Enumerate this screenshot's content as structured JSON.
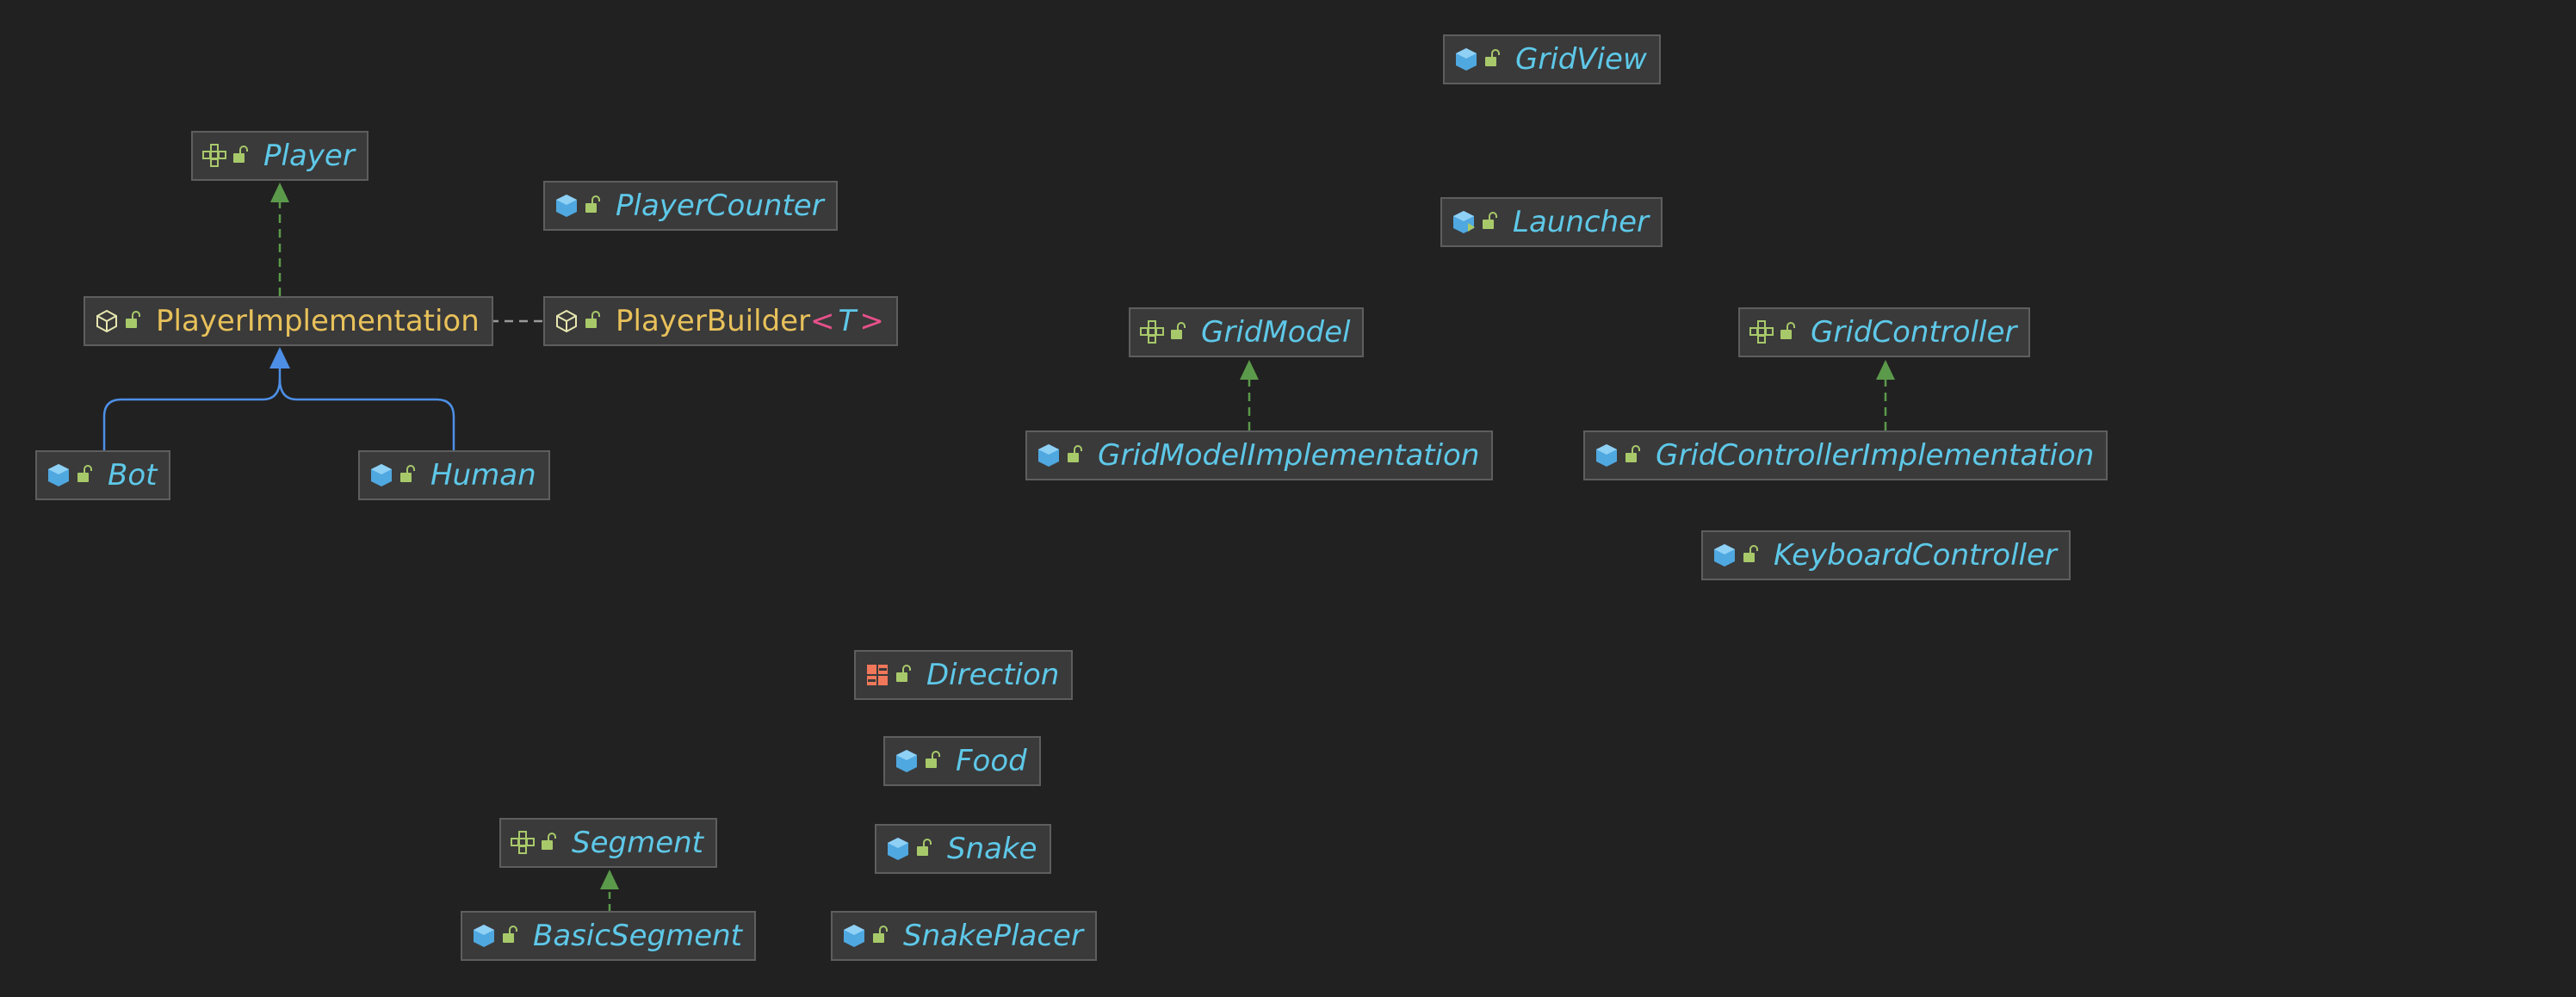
{
  "diagram": {
    "nodes": {
      "player": {
        "label": "Player",
        "kind": "interface-icon"
      },
      "player_counter": {
        "label": "PlayerCounter",
        "kind": "class-icon"
      },
      "player_implementation": {
        "label": "PlayerImplementation",
        "kind": "open-class-icon"
      },
      "player_builder": {
        "label": "PlayerBuilder",
        "type_param": "T",
        "lt": "<",
        "gt": ">",
        "kind": "open-class-icon"
      },
      "bot": {
        "label": "Bot",
        "kind": "class-icon"
      },
      "human": {
        "label": "Human",
        "kind": "class-icon"
      },
      "grid_view": {
        "label": "GridView",
        "kind": "class-icon"
      },
      "launcher": {
        "label": "Launcher",
        "kind": "launcher-class-icon"
      },
      "grid_model": {
        "label": "GridModel",
        "kind": "interface-icon"
      },
      "grid_controller": {
        "label": "GridController",
        "kind": "interface-icon"
      },
      "grid_model_implementation": {
        "label": "GridModelImplementation",
        "kind": "class-icon"
      },
      "grid_controller_implementation": {
        "label": "GridControllerImplementation",
        "kind": "class-icon"
      },
      "keyboard_controller": {
        "label": "KeyboardController",
        "kind": "class-icon"
      },
      "direction": {
        "label": "Direction",
        "kind": "enum-icon"
      },
      "food": {
        "label": "Food",
        "kind": "class-icon"
      },
      "segment": {
        "label": "Segment",
        "kind": "interface-icon"
      },
      "snake": {
        "label": "Snake",
        "kind": "class-icon"
      },
      "basic_segment": {
        "label": "BasicSegment",
        "kind": "class-icon"
      },
      "snake_placer": {
        "label": "SnakePlacer",
        "kind": "class-icon"
      }
    },
    "edges": [
      {
        "from": "player_implementation",
        "to": "player",
        "type": "realization"
      },
      {
        "from": "player_builder",
        "to": "player_implementation",
        "type": "dependency"
      },
      {
        "from": "bot",
        "to": "player_implementation",
        "type": "generalization"
      },
      {
        "from": "human",
        "to": "player_implementation",
        "type": "generalization"
      },
      {
        "from": "grid_model_implementation",
        "to": "grid_model",
        "type": "realization"
      },
      {
        "from": "grid_controller_implementation",
        "to": "grid_controller",
        "type": "realization"
      },
      {
        "from": "basic_segment",
        "to": "segment",
        "type": "realization"
      }
    ]
  },
  "colors": {
    "background": "#212121",
    "node_fill": "#3a3a3a",
    "node_border": "#5e5e5e",
    "label_text": "#5ec8e8",
    "open_class_text": "#e8c15a",
    "type_bracket": "#e8508a",
    "realization_edge": "#5b9a4a",
    "generalization_edge": "#4d8fe6",
    "dependency_edge": "#9a9a9a",
    "lock_icon": "#a8c96a"
  }
}
